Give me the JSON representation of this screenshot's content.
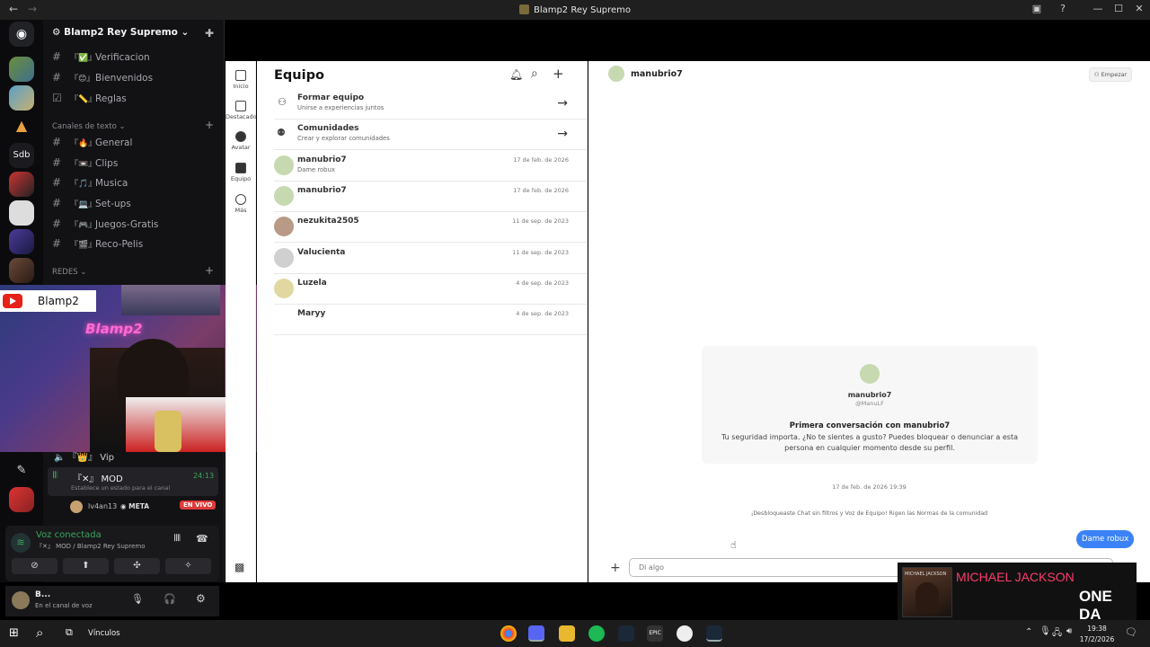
{
  "window": {
    "title": "Blamp2 Rey Supremo"
  },
  "guild": {
    "name": "Blamp2 Rey Supremo"
  },
  "channels_top": [
    {
      "emoji": "『✅』",
      "name": "Verificacion"
    },
    {
      "emoji": "『😊』",
      "name": "Bienvenidos"
    },
    {
      "emoji": "『📏』",
      "name": "Reglas"
    }
  ],
  "cat_text": "Canales de texto",
  "channels_text": [
    {
      "emoji": "『🔥』",
      "name": "General"
    },
    {
      "emoji": "『📼』",
      "name": "Clips"
    },
    {
      "emoji": "『🎵』",
      "name": "Musica"
    },
    {
      "emoji": "『💻』",
      "name": "Set-ups"
    },
    {
      "emoji": "『🎮』",
      "name": "Juegos-Gratis"
    },
    {
      "emoji": "『🎬』",
      "name": "Reco-Pelis"
    }
  ],
  "cat_redes": "REDES",
  "overlay": {
    "channel_name": "Blamp2",
    "neon": "Blamp2"
  },
  "voice": {
    "vip": "『👑』 Vip",
    "mod": "『✕』 MOD",
    "mod_timer": "24:13",
    "set_status": "Establece un estado para el canal",
    "member": "lv4an13",
    "member_tag": "META",
    "live_badge": "EN VIVO",
    "connected": "Voz conectada",
    "location": "『✕』 MOD / Blamp2 Rey Supremo"
  },
  "user": {
    "name": "B...",
    "status": "En el canal de voz"
  },
  "roblox_nav": [
    "Inicio",
    "Destacados",
    "Avatar",
    "Equipo",
    "Más"
  ],
  "list": {
    "title": "Equipo",
    "actions": [
      {
        "name": "Formar equipo",
        "sub": "Unirse a experiencias juntos"
      },
      {
        "name": "Comunidades",
        "sub": "Crear y explorar comunidades"
      }
    ],
    "convos": [
      {
        "name": "manubrio7",
        "sub": "Dame robux",
        "date": "17 de feb. de 2026"
      },
      {
        "name": "manubrio7",
        "sub": "",
        "date": "17 de feb. de 2026"
      },
      {
        "name": "nezukita2505",
        "sub": "",
        "date": "11 de sep. de 2023"
      },
      {
        "name": "Valucienta",
        "sub": "",
        "date": "11 de sep. de 2023"
      },
      {
        "name": "Luzela",
        "sub": "",
        "date": "4 de sep. de 2023"
      },
      {
        "name": "Maryy",
        "sub": "",
        "date": "4 de sep. de 2023"
      }
    ]
  },
  "chat": {
    "name": "manubrio7",
    "empezar": "Empezar",
    "card_name": "manubrio7",
    "card_handle": "@ManuLF",
    "card_title": "Primera conversación con manubrio7",
    "card_body": "Tu seguridad importa. ¿No te sientes a gusto? Puedes bloquear o denunciar a esta persona en cualquier momento desde su perfil.",
    "timestamp": "17 de feb. de 2026 19:39",
    "notice": "¡Desbloqueaste Chat sin filtros y Voz de Equipo! Rigen las Normas de la comunidad",
    "message": "Dame robux",
    "placeholder": "Di algo"
  },
  "music": {
    "artist": "MICHAEL JACKSON",
    "song": "ONE DA",
    "album_text": "MICHAEL JACKSON"
  },
  "taskbar": {
    "links": "Vínculos",
    "time": "19:38",
    "date": "17/2/2026"
  }
}
